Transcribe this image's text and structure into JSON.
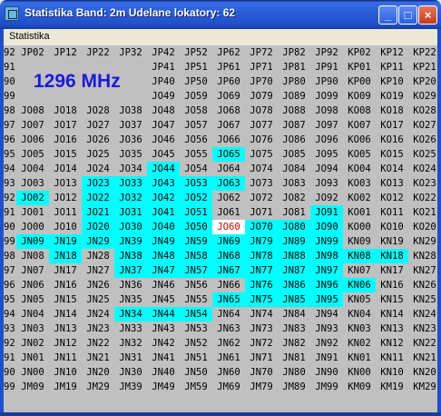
{
  "window": {
    "title": "Statistika  Band:  2m  Udelane lokatory: 62"
  },
  "menu": [
    "Statistika"
  ],
  "frequency_label": "1296 MHz",
  "colors": {
    "worked": "#00ffff",
    "own_square": "#cc0000",
    "background": "#c0c0c0",
    "freq_text": "#1a1adc"
  },
  "rows": [
    {
      "lat": "92",
      "cells": [
        "JP02",
        "JP12",
        "JP22",
        "JP32",
        "JP42",
        "JP52",
        "JP62",
        "JP72",
        "JP82",
        "JP92",
        "KP02",
        "KP12",
        "KP22"
      ]
    },
    {
      "lat": "91",
      "cells": [
        "",
        "",
        "",
        "",
        "JP41",
        "JP51",
        "JP61",
        "JP71",
        "JP81",
        "JP91",
        "KP01",
        "KP11",
        "KP21"
      ]
    },
    {
      "lat": "90",
      "cells": [
        "",
        "",
        "",
        "",
        "JP40",
        "JP50",
        "JP60",
        "JP70",
        "JP80",
        "JP90",
        "KP00",
        "KP10",
        "KP20"
      ]
    },
    {
      "lat": "99",
      "cells": [
        "",
        "",
        "",
        "",
        "JO49",
        "JO59",
        "JO69",
        "JO79",
        "JO89",
        "JO99",
        "KO09",
        "KO19",
        "KO29"
      ]
    },
    {
      "lat": "98",
      "cells": [
        "JO08",
        "JO18",
        "JO28",
        "JO38",
        "JO48",
        "JO58",
        "JO68",
        "JO78",
        "JO88",
        "JO98",
        "KO08",
        "KO18",
        "KO28"
      ]
    },
    {
      "lat": "97",
      "cells": [
        "JO07",
        "JO17",
        "JO27",
        "JO37",
        "JO47",
        "JO57",
        "JO67",
        "JO77",
        "JO87",
        "JO97",
        "KO07",
        "KO17",
        "KO27"
      ]
    },
    {
      "lat": "96",
      "cells": [
        "JO06",
        "JO16",
        "JO26",
        "JO36",
        "JO46",
        "JO56",
        "JO66",
        "JO76",
        "JO86",
        "JO96",
        "KO06",
        "KO16",
        "KO26"
      ]
    },
    {
      "lat": "95",
      "cells": [
        "JO05",
        "JO15",
        "JO25",
        "JO35",
        "JO45",
        "JO55",
        "JO65",
        "JO75",
        "JO85",
        "JO95",
        "KO05",
        "KO15",
        "KO25"
      ]
    },
    {
      "lat": "94",
      "cells": [
        "JO04",
        "JO14",
        "JO24",
        "JO34",
        "JO44",
        "JO54",
        "JO64",
        "JO74",
        "JO84",
        "JO94",
        "KO04",
        "KO14",
        "KO24"
      ]
    },
    {
      "lat": "93",
      "cells": [
        "JO03",
        "JO13",
        "JO23",
        "JO33",
        "JO43",
        "JO53",
        "JO63",
        "JO73",
        "JO83",
        "JO93",
        "KO03",
        "KO13",
        "KO23"
      ]
    },
    {
      "lat": "92",
      "cells": [
        "JO02",
        "JO12",
        "JO22",
        "JO32",
        "JO42",
        "JO52",
        "JO62",
        "JO72",
        "JO82",
        "JO92",
        "KO02",
        "KO12",
        "KO22"
      ]
    },
    {
      "lat": "91",
      "cells": [
        "JO01",
        "JO11",
        "JO21",
        "JO31",
        "JO41",
        "JO51",
        "JO61",
        "JO71",
        "JO81",
        "JO91",
        "KO01",
        "KO11",
        "KO21"
      ]
    },
    {
      "lat": "90",
      "cells": [
        "JO00",
        "JO10",
        "JO20",
        "JO30",
        "JO40",
        "JO50",
        "JO60",
        "JO70",
        "JO80",
        "JO90",
        "KO00",
        "KO10",
        "KO20"
      ]
    },
    {
      "lat": "99",
      "cells": [
        "JN09",
        "JN19",
        "JN29",
        "JN39",
        "JN49",
        "JN59",
        "JN69",
        "JN79",
        "JN89",
        "JN99",
        "KN09",
        "KN19",
        "KN29"
      ]
    },
    {
      "lat": "98",
      "cells": [
        "JN08",
        "JN18",
        "JN28",
        "JN38",
        "JN48",
        "JN58",
        "JN68",
        "JN78",
        "JN88",
        "JN98",
        "KN08",
        "KN18",
        "KN28"
      ]
    },
    {
      "lat": "97",
      "cells": [
        "JN07",
        "JN17",
        "JN27",
        "JN37",
        "JN47",
        "JN57",
        "JN67",
        "JN77",
        "JN87",
        "JN97",
        "KN07",
        "KN17",
        "KN27"
      ]
    },
    {
      "lat": "96",
      "cells": [
        "JN06",
        "JN16",
        "JN26",
        "JN36",
        "JN46",
        "JN56",
        "JN66",
        "JN76",
        "JN86",
        "JN96",
        "KN06",
        "KN16",
        "KN26"
      ]
    },
    {
      "lat": "95",
      "cells": [
        "JN05",
        "JN15",
        "JN25",
        "JN35",
        "JN45",
        "JN55",
        "JN65",
        "JN75",
        "JN85",
        "JN95",
        "KN05",
        "KN15",
        "KN25"
      ]
    },
    {
      "lat": "94",
      "cells": [
        "JN04",
        "JN14",
        "JN24",
        "JN34",
        "JN44",
        "JN54",
        "JN64",
        "JN74",
        "JN84",
        "JN94",
        "KN04",
        "KN14",
        "KN24"
      ]
    },
    {
      "lat": "93",
      "cells": [
        "JN03",
        "JN13",
        "JN23",
        "JN33",
        "JN43",
        "JN53",
        "JN63",
        "JN73",
        "JN83",
        "JN93",
        "KN03",
        "KN13",
        "KN23"
      ]
    },
    {
      "lat": "92",
      "cells": [
        "JN02",
        "JN12",
        "JN22",
        "JN32",
        "JN42",
        "JN52",
        "JN62",
        "JN72",
        "JN82",
        "JN92",
        "KN02",
        "KN12",
        "KN22"
      ]
    },
    {
      "lat": "91",
      "cells": [
        "JN01",
        "JN11",
        "JN21",
        "JN31",
        "JN41",
        "JN51",
        "JN61",
        "JN71",
        "JN81",
        "JN91",
        "KN01",
        "KN11",
        "KN21"
      ]
    },
    {
      "lat": "90",
      "cells": [
        "JN00",
        "JN10",
        "JN20",
        "JN30",
        "JN40",
        "JN50",
        "JN60",
        "JN70",
        "JN80",
        "JN90",
        "KN00",
        "KN10",
        "KN20"
      ]
    },
    {
      "lat": "99",
      "cells": [
        "JM09",
        "JM19",
        "JM29",
        "JM39",
        "JM49",
        "JM59",
        "JM69",
        "JM79",
        "JM89",
        "JM99",
        "KM09",
        "KM19",
        "KM29"
      ]
    }
  ],
  "worked": [
    "JO65",
    "JO44",
    "JO23",
    "JO33",
    "JO43",
    "JO53",
    "JO63",
    "JO02",
    "JO22",
    "JO32",
    "JO42",
    "JO52",
    "JO21",
    "JO31",
    "JO41",
    "JO51",
    "JO91",
    "JO20",
    "JO30",
    "JO40",
    "JO50",
    "JO70",
    "JO80",
    "JO90",
    "JN09",
    "JN19",
    "JN29",
    "JN39",
    "JN49",
    "JN59",
    "JN69",
    "JN79",
    "JN89",
    "JN99",
    "JN18",
    "JN38",
    "JN48",
    "JN58",
    "JN68",
    "JN78",
    "JN88",
    "JN98",
    "KN08",
    "KN18",
    "JN37",
    "JN47",
    "JN57",
    "JN67",
    "JN77",
    "JN87",
    "JN97",
    "JN76",
    "JN86",
    "JN96",
    "KN06",
    "JN65",
    "JN75",
    "JN85",
    "JN95",
    "JN34",
    "JN44",
    "JN54"
  ],
  "own": "JO60"
}
